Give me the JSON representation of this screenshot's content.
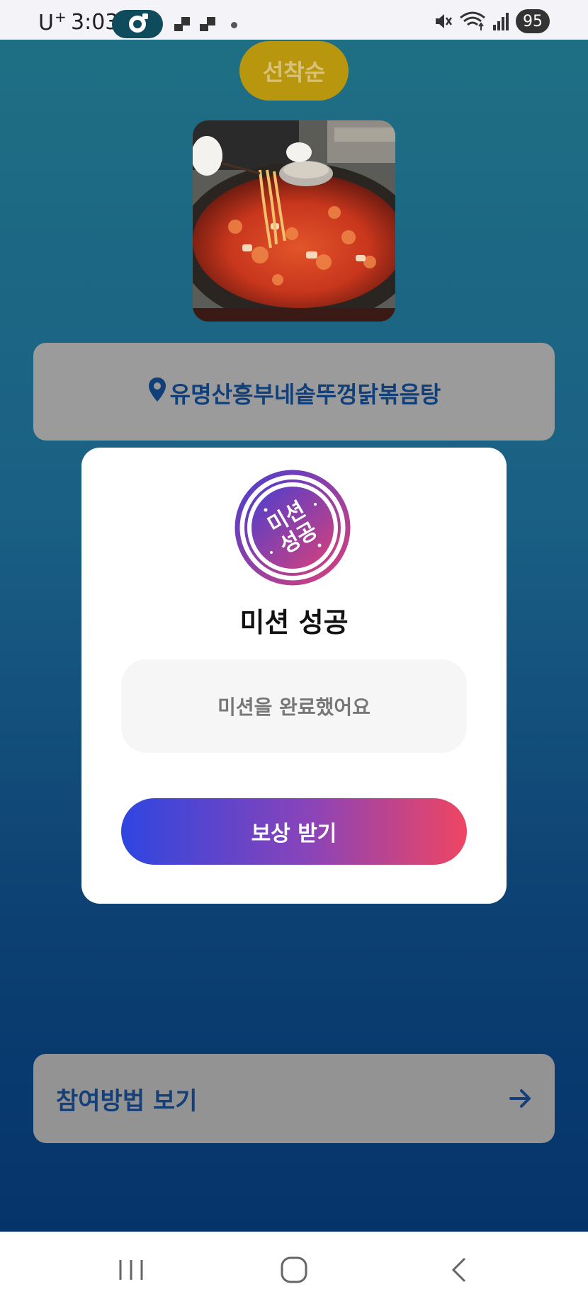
{
  "status_bar": {
    "carrier": "U",
    "carrier_sup": "+",
    "time": "3:03",
    "battery": "95",
    "icons": [
      "app-notification-icon",
      "notification-icon",
      "notification-icon",
      "dot-icon",
      "mute-icon",
      "wifi-icon",
      "signal-icon"
    ]
  },
  "header": {
    "badge_label": "선착순"
  },
  "place": {
    "name": "유명산흥부네솥뚜껑닭볶음탕"
  },
  "howto": {
    "label": "참여방법 보기"
  },
  "modal": {
    "stamp_text_line1": "미션",
    "stamp_text_line2": "성공",
    "title": "미션 성공",
    "message": "미션을 완료했어요",
    "button_label": "보상 받기"
  },
  "nav": {
    "items": [
      "recent-apps-icon",
      "home-icon",
      "back-icon"
    ]
  },
  "colors": {
    "badge": "#b8960e",
    "place_text": "#113f79",
    "button_gradient_start": "#2f45e0",
    "button_gradient_end": "#ef4562"
  }
}
